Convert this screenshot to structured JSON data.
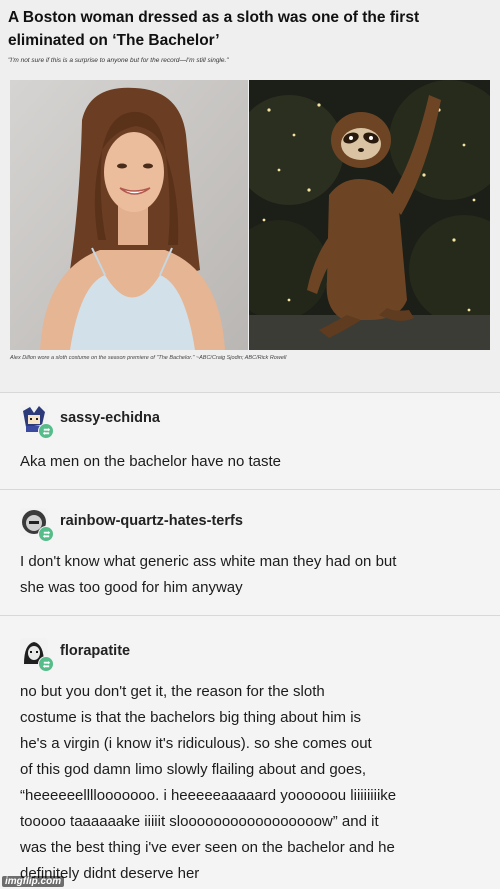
{
  "article": {
    "headline": "A Boston woman dressed as a sloth was one of the first eliminated on ‘The Bachelor’",
    "quote": "\"I'm not sure if this is a surprise to anyone but for the record—I'm still single.\"",
    "caption": "Alex Dillon wore a sloth costume on the season premiere of \"The Bachelor.\" ~ABC/Craig Sjodin; ABC/Rick Rowell"
  },
  "posts": [
    {
      "username": "sassy-echidna",
      "text": "Aka men on the bachelor have no taste"
    },
    {
      "username": "rainbow-quartz-hates-terfs",
      "lines": [
        "I don't know what generic ass white man they had on but",
        "she was too good for him anyway"
      ]
    },
    {
      "username": "florapatite",
      "lines": [
        "no but you don't get it, the reason for the sloth",
        "costume is that the bachelors big thing about him is",
        "he's a virgin (i know it's ridiculous). so she comes out",
        "of this god damn limo slowly flailing about and goes,",
        "“heeeeeellllooooooo. i heeeeeaaaaard yoooooou liiiiiiiike",
        "tooooo taaaaaake iiiiit slooooooooooooooooow” and it",
        "was the best thing i've ever seen on the bachelor and he",
        "definitely didnt deserve her"
      ]
    }
  ],
  "watermark": "imgflip.com",
  "colors": {
    "reblog_green": "#56bc8a",
    "post_bg": "#f4f4f4"
  },
  "icons": [
    "reblog-icon",
    "avatar"
  ]
}
